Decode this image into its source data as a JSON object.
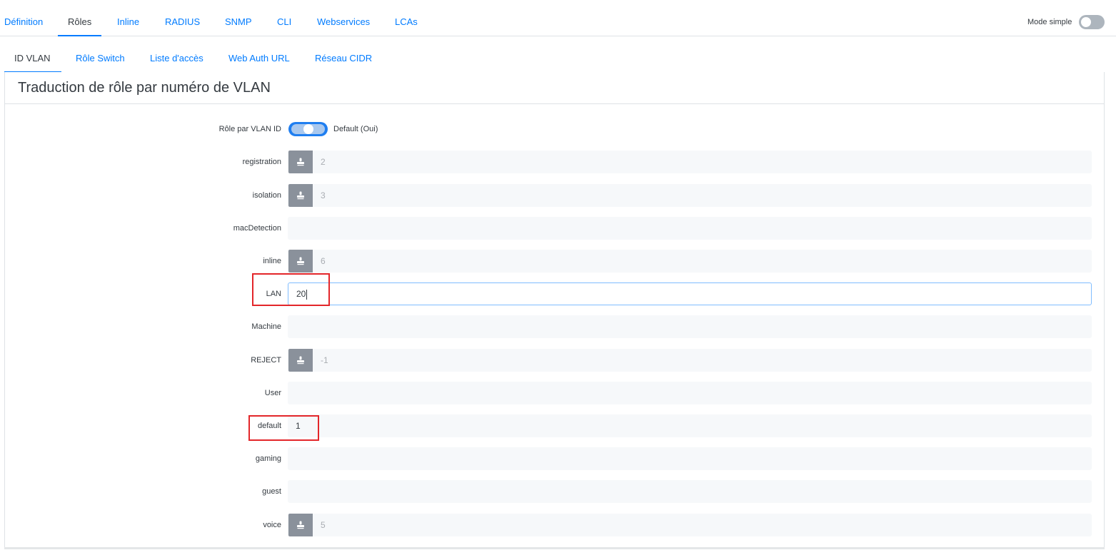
{
  "top_tabs": [
    {
      "label": "Définition",
      "active": false
    },
    {
      "label": "Rôles",
      "active": true
    },
    {
      "label": "Inline",
      "active": false
    },
    {
      "label": "RADIUS",
      "active": false
    },
    {
      "label": "SNMP",
      "active": false
    },
    {
      "label": "CLI",
      "active": false
    },
    {
      "label": "Webservices",
      "active": false
    },
    {
      "label": "LCAs",
      "active": false
    }
  ],
  "mode_simple": {
    "label": "Mode simple",
    "enabled": false
  },
  "sub_tabs": [
    {
      "label": "ID VLAN",
      "active": true
    },
    {
      "label": "Rôle Switch",
      "active": false
    },
    {
      "label": "Liste d'accès",
      "active": false
    },
    {
      "label": "Web Auth URL",
      "active": false
    },
    {
      "label": "Réseau CIDR",
      "active": false
    }
  ],
  "card": {
    "title": "Traduction de rôle par numéro de VLAN",
    "role_by_vlan": {
      "label": "Rôle par VLAN ID",
      "value_text": "Default (Oui)",
      "enabled": true
    },
    "fields": [
      {
        "label": "registration",
        "value": "",
        "placeholder": "2",
        "has_default_button": true
      },
      {
        "label": "isolation",
        "value": "",
        "placeholder": "3",
        "has_default_button": true
      },
      {
        "label": "macDetection",
        "value": "",
        "placeholder": "",
        "has_default_button": false
      },
      {
        "label": "inline",
        "value": "",
        "placeholder": "6",
        "has_default_button": true
      },
      {
        "label": "LAN",
        "value": "20",
        "placeholder": "",
        "has_default_button": false,
        "focused": true
      },
      {
        "label": "Machine",
        "value": "",
        "placeholder": "",
        "has_default_button": false
      },
      {
        "label": "REJECT",
        "value": "",
        "placeholder": "-1",
        "has_default_button": true
      },
      {
        "label": "User",
        "value": "",
        "placeholder": "",
        "has_default_button": false
      },
      {
        "label": "default",
        "value": "1",
        "placeholder": "",
        "has_default_button": false
      },
      {
        "label": "gaming",
        "value": "",
        "placeholder": "",
        "has_default_button": false
      },
      {
        "label": "guest",
        "value": "",
        "placeholder": "",
        "has_default_button": false
      },
      {
        "label": "voice",
        "value": "",
        "placeholder": "5",
        "has_default_button": true
      }
    ]
  },
  "icons": {
    "default_button": "stamp-icon"
  },
  "colors": {
    "accent": "#007bff",
    "highlight": "#e3262a",
    "button_gray": "#8a919b"
  }
}
